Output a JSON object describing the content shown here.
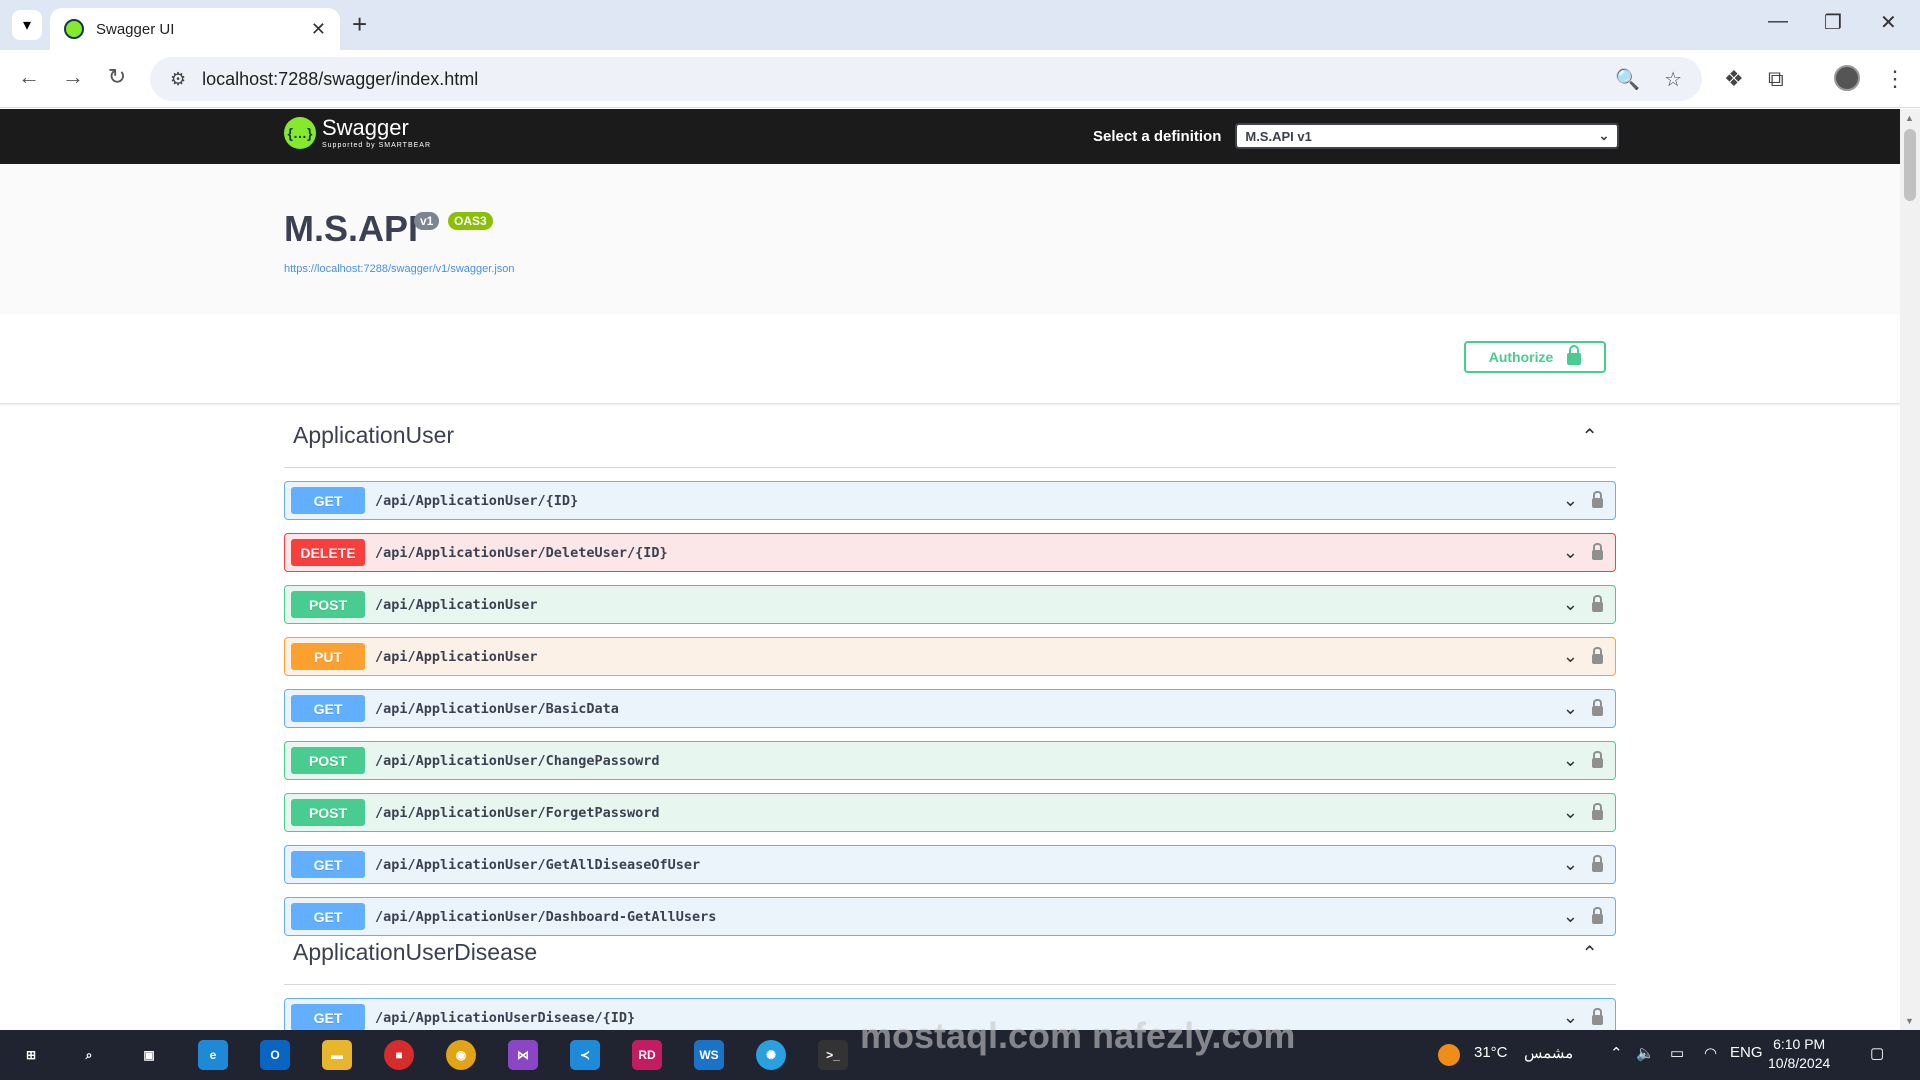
{
  "browser": {
    "tab_title": "Swagger UI",
    "url": "localhost:7288/swagger/index.html"
  },
  "swagger": {
    "logo_text": "Swagger",
    "logo_sub": "Supported by SMARTBEAR",
    "definition_label": "Select a definition",
    "definition_value": "M.S.API v1",
    "api_title": "M.S.API",
    "version_badge": "v1",
    "oas_badge": "OAS3",
    "spec_url": "https://localhost:7288/swagger/v1/swagger.json",
    "authorize_label": "Authorize"
  },
  "tags": [
    {
      "name": "ApplicationUser",
      "ops": [
        {
          "method": "GET",
          "path": "/api/ApplicationUser/{ID}"
        },
        {
          "method": "DELETE",
          "path": "/api/ApplicationUser/DeleteUser/{ID}"
        },
        {
          "method": "POST",
          "path": "/api/ApplicationUser"
        },
        {
          "method": "PUT",
          "path": "/api/ApplicationUser"
        },
        {
          "method": "GET",
          "path": "/api/ApplicationUser/BasicData"
        },
        {
          "method": "POST",
          "path": "/api/ApplicationUser/ChangePassowrd"
        },
        {
          "method": "POST",
          "path": "/api/ApplicationUser/ForgetPassword"
        },
        {
          "method": "GET",
          "path": "/api/ApplicationUser/GetAllDiseaseOfUser"
        },
        {
          "method": "GET",
          "path": "/api/ApplicationUser/Dashboard-GetAllUsers"
        }
      ]
    },
    {
      "name": "ApplicationUserDisease",
      "ops": [
        {
          "method": "GET",
          "path": "/api/ApplicationUserDisease/{ID}"
        }
      ]
    }
  ],
  "taskbar": {
    "weather": "31°C",
    "weather_desc": "مشمس",
    "lang": "ENG",
    "time": "6:10 PM",
    "date": "10/8/2024"
  },
  "watermark": "mostaql.com nafezly.com"
}
